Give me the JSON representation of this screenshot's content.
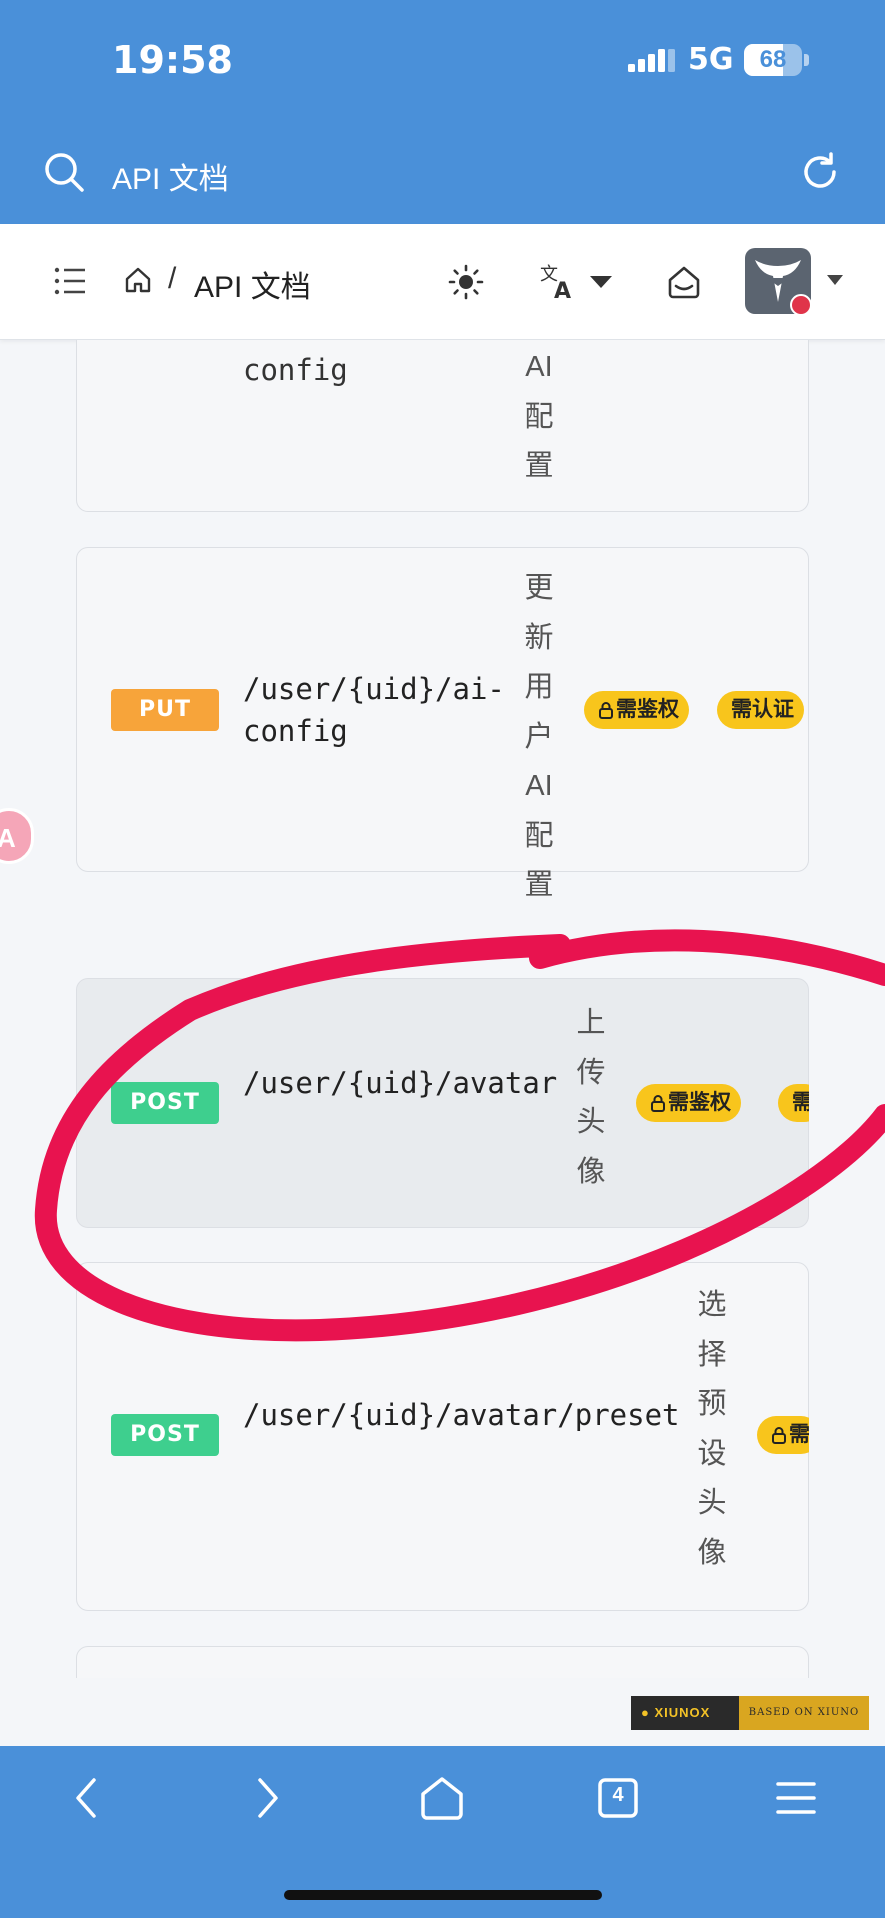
{
  "status_bar": {
    "time": "19:58",
    "network": "5G",
    "battery_level": "68",
    "battery_fraction": 0.68
  },
  "browser": {
    "title": "API 文档",
    "search_icon": "search-icon",
    "reload_icon": "reload-icon"
  },
  "nav": {
    "menu_icon": "list-menu-icon",
    "home_icon": "home-icon",
    "separator": "/",
    "breadcrumb_title": "API 文档",
    "theme_icon": "sun-icon",
    "language_icon": "translate-icon",
    "notification_icon": "inbox-icon"
  },
  "cards": [
    {
      "method": "",
      "path": "config",
      "summary_chars": [
        "AI",
        "配",
        "置"
      ]
    },
    {
      "method": "PUT",
      "path_line1": "/user/{uid}/ai-",
      "path_line2": "config",
      "summary_chars": [
        "更",
        "新",
        "用",
        "户",
        "AI",
        "配",
        "置"
      ],
      "badges": [
        "需鉴权",
        "需认证"
      ]
    },
    {
      "method": "POST",
      "path": "/user/{uid}/avatar",
      "summary_chars": [
        "上",
        "传",
        "头",
        "像"
      ],
      "badges": [
        "需鉴权",
        "需"
      ]
    },
    {
      "method": "POST",
      "path": "/user/{uid}/avatar/preset",
      "summary_chars": [
        "选",
        "择",
        "预",
        "设",
        "头",
        "像"
      ],
      "badges": [
        "需"
      ]
    }
  ],
  "side_bubble": {
    "label": "A"
  },
  "footer_badge": {
    "left": "XIUNOX",
    "right": "BASED ON XIUNO"
  },
  "bottom_bar": {
    "tabs_count": "4",
    "icons": [
      "back-icon",
      "forward-icon",
      "home-icon",
      "tabs-icon",
      "menu-icon"
    ]
  },
  "colors": {
    "accent": "#4a90d9",
    "put": "#f7a43a",
    "post": "#3ecf8e",
    "badge": "#f8c51c",
    "annotation": "#e8134f"
  }
}
